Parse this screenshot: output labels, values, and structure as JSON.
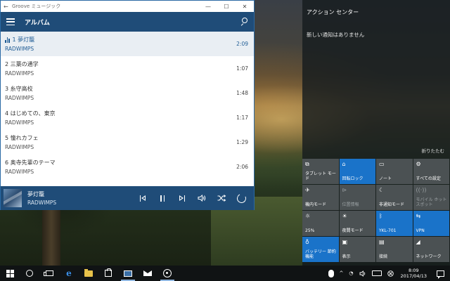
{
  "window": {
    "title": "Groove ミュージック",
    "back_glyph": "←",
    "controls": [
      "—",
      "☐",
      "✕"
    ]
  },
  "app": {
    "title": "アルバム"
  },
  "tracks": [
    {
      "number_title": "1  夢灯籠",
      "artist": "RADWIMPS",
      "duration": "2:09",
      "current": true
    },
    {
      "number_title": "2  三葉の通学",
      "artist": "RADWIMPS",
      "duration": "1:07",
      "current": false
    },
    {
      "number_title": "3  糸守高校",
      "artist": "RADWIMPS",
      "duration": "1:48",
      "current": false
    },
    {
      "number_title": "4  はじめての、東京",
      "artist": "RADWIMPS",
      "duration": "1:17",
      "current": false
    },
    {
      "number_title": "5  憧れカフェ",
      "artist": "RADWIMPS",
      "duration": "1:29",
      "current": false
    },
    {
      "number_title": "6  奥寺先輩のテーマ",
      "artist": "RADWIMPS",
      "duration": "2:06",
      "current": false
    }
  ],
  "now_playing": {
    "title": "夢灯籠",
    "artist": "RADWIMPS",
    "icons": [
      "previous-icon",
      "pause-icon",
      "next-icon",
      "volume-icon",
      "shuffle-icon",
      "repeat-icon"
    ]
  },
  "action_center": {
    "header": "アクション センター",
    "empty_message": "新しい通知はありません",
    "collapse_label": "折りたたむ",
    "tiles": [
      {
        "label": "タブレット モード",
        "icon": "tablet-mode-icon",
        "glyph": "⧉",
        "state": "off"
      },
      {
        "label": "回転ロック",
        "icon": "rotation-lock-icon",
        "glyph": "⌂",
        "state": "on"
      },
      {
        "label": "ノート",
        "icon": "note-icon",
        "glyph": "▭",
        "state": "off"
      },
      {
        "label": "すべての設定",
        "icon": "settings-icon",
        "glyph": "⚙",
        "state": "off"
      },
      {
        "label": "機内モード",
        "icon": "airplane-icon",
        "glyph": "✈",
        "state": "off"
      },
      {
        "label": "位置情報",
        "icon": "location-icon",
        "glyph": "⊳",
        "state": "dim"
      },
      {
        "label": "非通知モード",
        "icon": "quiet-hours-icon",
        "glyph": "☾",
        "state": "off"
      },
      {
        "label": "モバイル ホットスポット",
        "icon": "hotspot-icon",
        "glyph": "((·))",
        "state": "dim"
      },
      {
        "label": "25%",
        "icon": "brightness-icon",
        "glyph": "☼",
        "state": "off"
      },
      {
        "label": "夜間モード",
        "icon": "night-light-icon",
        "glyph": "☀",
        "state": "off"
      },
      {
        "label": "YKL-701",
        "icon": "bluetooth-icon",
        "glyph": "ᛒ",
        "state": "on"
      },
      {
        "label": "VPN",
        "icon": "vpn-icon",
        "glyph": "⇆",
        "state": "on"
      },
      {
        "label": "バッテリー 節約機能",
        "icon": "battery-saver-icon",
        "glyph": "♁",
        "state": "on"
      },
      {
        "label": "表示",
        "icon": "project-icon",
        "glyph": "▣",
        "state": "off"
      },
      {
        "label": "接続",
        "icon": "connect-icon",
        "glyph": "▤",
        "state": "off"
      },
      {
        "label": "ネットワーク",
        "icon": "network-icon",
        "glyph": "◢",
        "state": "off"
      }
    ]
  },
  "taskbar": {
    "clock_time": "8:09",
    "clock_date": "2017/04/13",
    "tray_glyphs": {
      "chevron": "^",
      "volume": "🔊",
      "wifi": "◔"
    }
  },
  "colors": {
    "accent": "#1f4c78",
    "tile_on": "#1a73c9",
    "tile_off": "#4b5153",
    "highlight_text": "#1f5c95"
  }
}
